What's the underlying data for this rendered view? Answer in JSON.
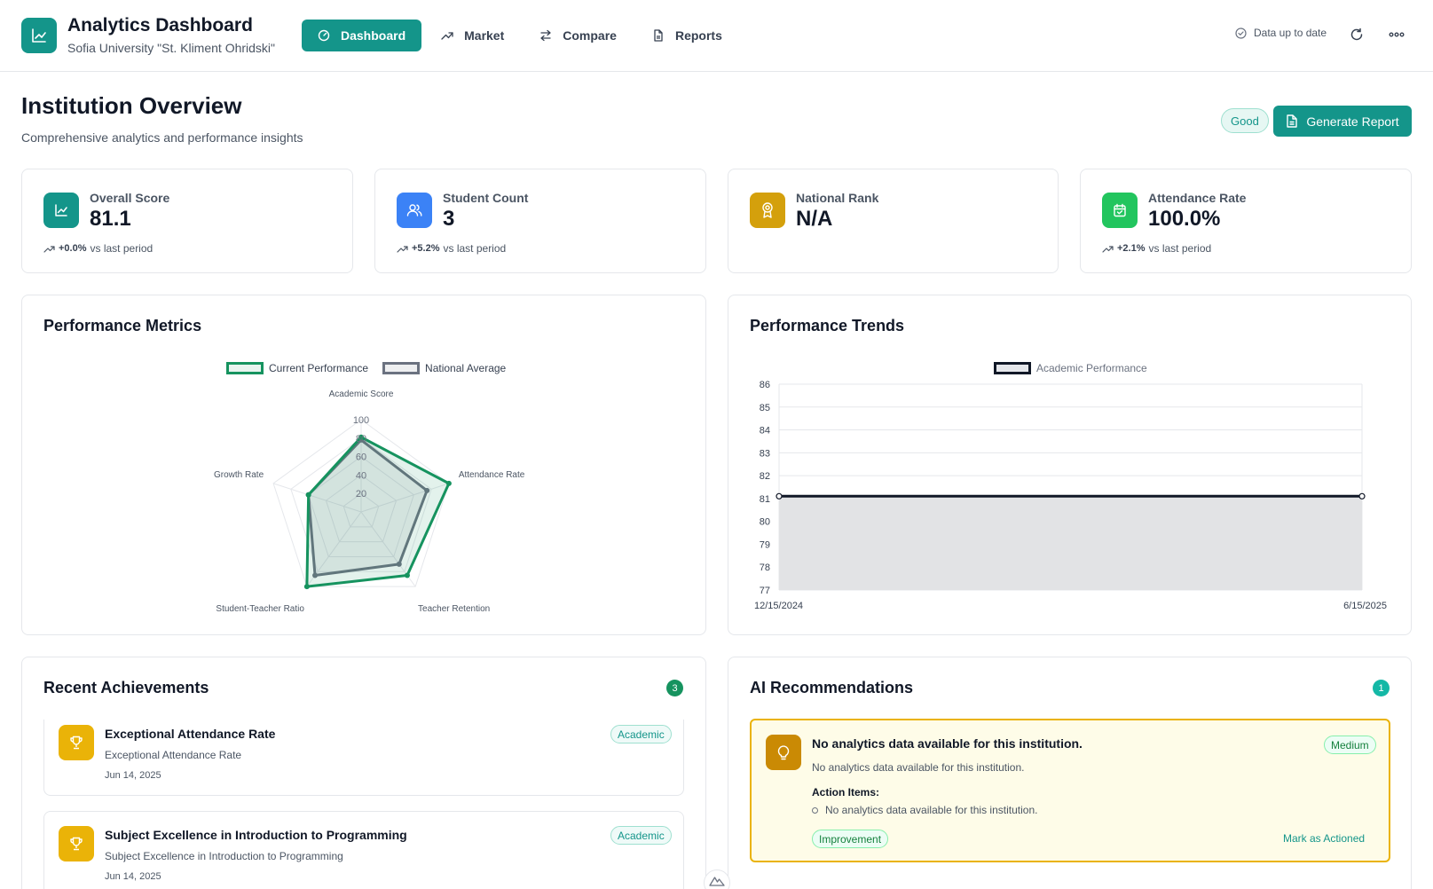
{
  "header": {
    "app_title": "Analytics Dashboard",
    "institution": "Sofia University \"St. Kliment Ohridski\"",
    "nav": [
      {
        "label": "Dashboard",
        "icon": "gauge-icon",
        "active": true
      },
      {
        "label": "Market",
        "icon": "trend-up-icon",
        "active": false
      },
      {
        "label": "Compare",
        "icon": "swap-icon",
        "active": false
      },
      {
        "label": "Reports",
        "icon": "file-icon",
        "active": false
      }
    ],
    "status": "Data up to date"
  },
  "page": {
    "title": "Institution Overview",
    "subtitle": "Comprehensive analytics and performance insights",
    "health_badge": "Good",
    "generate_button": "Generate Report"
  },
  "kpis": [
    {
      "label": "Overall Score",
      "value": "81.1",
      "change": "+0.0%",
      "change_suffix": "vs last period",
      "icon": "chart-line-icon",
      "color": "#14958a"
    },
    {
      "label": "Student Count",
      "value": "3",
      "change": "+5.2%",
      "change_suffix": "vs last period",
      "icon": "users-icon",
      "color": "#3b82f6"
    },
    {
      "label": "National Rank",
      "value": "N/A",
      "change": "",
      "change_suffix": "",
      "icon": "award-icon",
      "color": "#d4a00c"
    },
    {
      "label": "Attendance Rate",
      "value": "100.0%",
      "change": "+2.1%",
      "change_suffix": "vs last period",
      "icon": "calendar-check-icon",
      "color": "#22c55e"
    }
  ],
  "radar": {
    "title": "Performance Metrics",
    "chart_data": {
      "type": "radar",
      "categories": [
        "Academic Score",
        "Attendance Rate",
        "Teacher Retention",
        "Student-Teacher Ratio",
        "Growth Rate"
      ],
      "series": [
        {
          "name": "Current Performance",
          "values": [
            81,
            100,
            85,
            100,
            60
          ],
          "color": "#16935f"
        },
        {
          "name": "National Average",
          "values": [
            78,
            75,
            70,
            85,
            60
          ],
          "color": "#6b7280"
        }
      ],
      "ticks": [
        "20",
        "40",
        "60",
        "80",
        "100"
      ],
      "rlim": [
        0,
        100
      ]
    }
  },
  "trend": {
    "title": "Performance Trends",
    "chart_data": {
      "type": "area",
      "series": [
        {
          "name": "Academic Performance",
          "x": [
            "12/15/2024",
            "6/15/2025"
          ],
          "values": [
            81.1,
            81.1
          ],
          "color": "#111827"
        }
      ],
      "xlabels": [
        "12/15/2024",
        "6/15/2025"
      ],
      "yticks": [
        "77",
        "78",
        "79",
        "80",
        "81",
        "82",
        "83",
        "84",
        "85",
        "86"
      ],
      "ylim": [
        77,
        86
      ]
    }
  },
  "achievements": {
    "title": "Recent Achievements",
    "count": "3",
    "items": [
      {
        "title": "Exceptional Attendance Rate",
        "desc": "Exceptional Attendance Rate",
        "date": "Jun 14, 2025",
        "tag": "Academic"
      },
      {
        "title": "Subject Excellence in Introduction to Programming",
        "desc": "Subject Excellence in Introduction to Programming",
        "date": "Jun 14, 2025",
        "tag": "Academic"
      }
    ]
  },
  "recommendations": {
    "title": "AI Recommendations",
    "count": "1",
    "item": {
      "title": "No analytics data available for this institution.",
      "priority": "Medium",
      "desc": "No analytics data available for this institution.",
      "actions_label": "Action Items:",
      "actions": [
        "No analytics data available for this institution."
      ],
      "category": "Improvement",
      "mark_link": "Mark as Actioned"
    }
  }
}
